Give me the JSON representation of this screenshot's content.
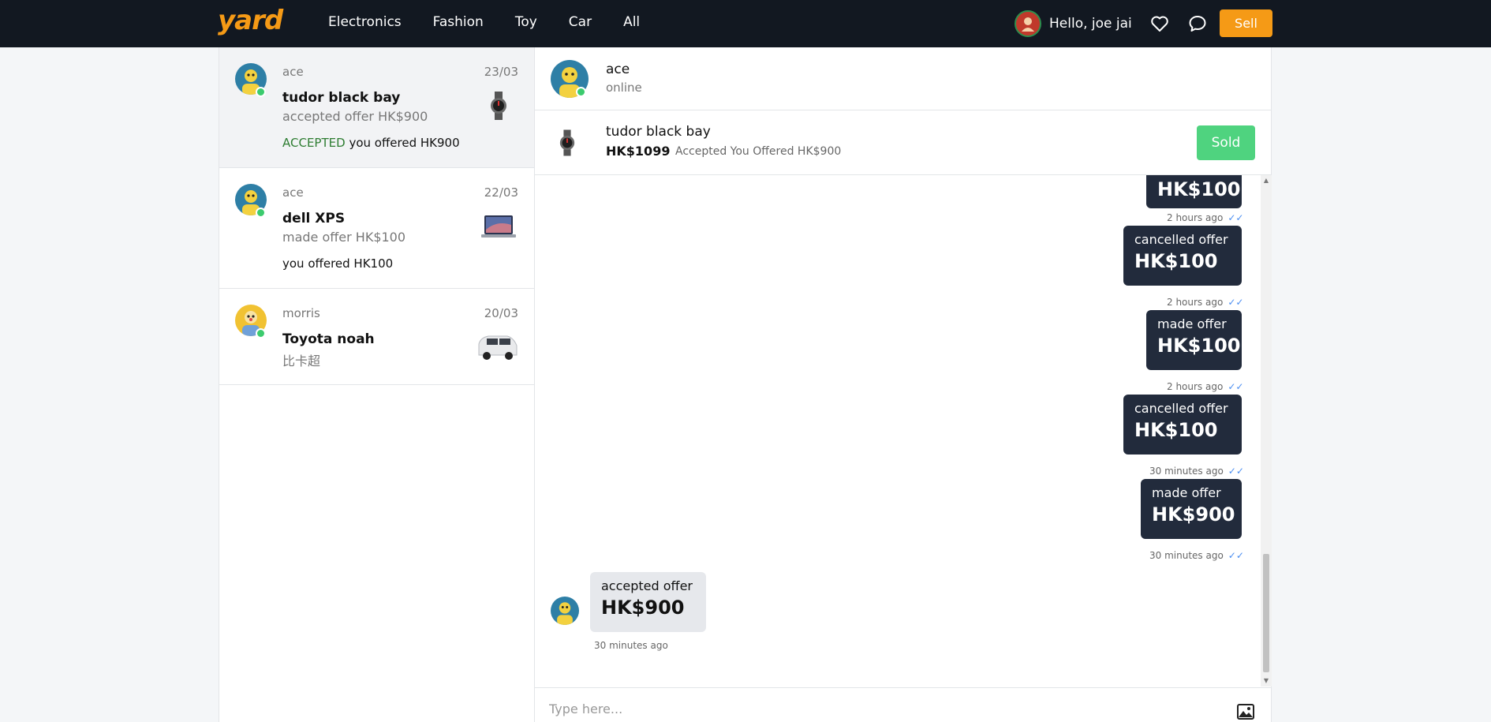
{
  "navbar": {
    "logo": "yard",
    "links": [
      "Electronics",
      "Fashion",
      "Toy",
      "Car",
      "All"
    ],
    "greeting": "Hello, joe jai",
    "sell_label": "Sell"
  },
  "conversations": [
    {
      "name": "ace",
      "date": "23/03",
      "title": "tudor black bay",
      "subtitle": "accepted offer HK$900",
      "status_tag": "ACCEPTED",
      "status_text": "you offered HK900",
      "thumb": "watch-icon",
      "active": true
    },
    {
      "name": "ace",
      "date": "22/03",
      "title": "dell XPS",
      "subtitle": "made offer HK$100",
      "status_tag": "",
      "status_text": "you offered HK100",
      "thumb": "laptop-icon",
      "active": false
    },
    {
      "name": "morris",
      "date": "20/03",
      "title": "Toyota noah",
      "subtitle": "比卡超",
      "status_tag": "",
      "status_text": "",
      "thumb": "car-icon",
      "active": false
    }
  ],
  "chat": {
    "contact_name": "ace",
    "presence": "online",
    "product": {
      "name": "tudor black bay",
      "price": "HK$1099",
      "offer_status": "Accepted You Offered HK$900",
      "sold_label": "Sold"
    },
    "messages": [
      {
        "label": "",
        "amount": "HK$100",
        "time": "2 hours ago",
        "direction": "sent"
      },
      {
        "label": "cancelled offer",
        "amount": "HK$100",
        "time": "2 hours ago",
        "direction": "sent"
      },
      {
        "label": "made offer",
        "amount": "HK$100",
        "time": "2 hours ago",
        "direction": "sent"
      },
      {
        "label": "cancelled offer",
        "amount": "HK$100",
        "time": "30 minutes ago",
        "direction": "sent"
      },
      {
        "label": "made offer",
        "amount": "HK$900",
        "time": "30 minutes ago",
        "direction": "sent"
      },
      {
        "label": "accepted offer",
        "amount": "HK$900",
        "time": "30 minutes ago",
        "direction": "received"
      }
    ],
    "composer_placeholder": "Type here..."
  },
  "colors": {
    "accent": "#f59a16",
    "navbar": "#121821",
    "bubble_sent": "#222b3c",
    "bubble_received": "#e6e8ec",
    "online": "#3ccb6e",
    "sold": "#4fd37f",
    "accepted": "#2e7d32"
  }
}
